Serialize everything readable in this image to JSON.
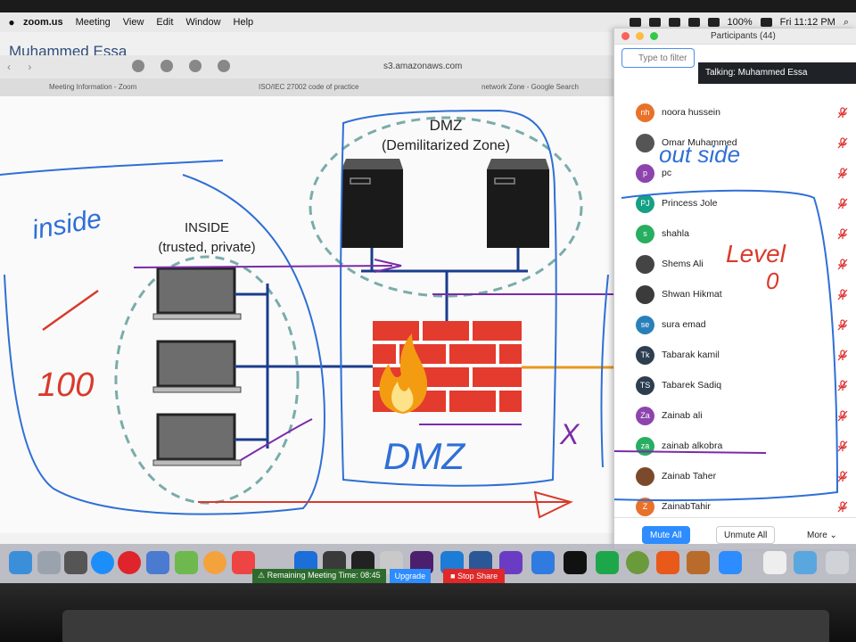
{
  "menubar": {
    "app": "zoom.us",
    "items": [
      "Meeting",
      "View",
      "Edit",
      "Window",
      "Help"
    ],
    "battery": "100%",
    "clock": "Fri 11:12 PM"
  },
  "window": {
    "meeting_name": "Muhammed Essa",
    "url": "s3.amazonaws.com",
    "tabs": [
      "Meeting Information - Zoom",
      "ISO/IEC 27002 code of practice",
      "network Zone - Google Search"
    ]
  },
  "diagram": {
    "dmz_title": "DMZ",
    "dmz_subtitle": "(Demilitarized Zone)",
    "inside_title": "INSIDE",
    "inside_subtitle": "(trusted, private)"
  },
  "annotations": {
    "inside": "inside",
    "check_mark": "✓",
    "score": "100",
    "dmz": "DMZ",
    "outside": "out side",
    "level": "Level",
    "level_num": "0",
    "x_mark": "X"
  },
  "panel": {
    "title": "Participants (44)",
    "search_placeholder": "Type to filter",
    "talking": "Talking: Muhammed Essa",
    "participants": [
      {
        "initials": "nh",
        "name": "noora hussein",
        "color": "#e8722a"
      },
      {
        "initials": "",
        "name": "Omar Muhammed",
        "color": "#555555"
      },
      {
        "initials": "p",
        "name": "pc",
        "color": "#8e44ad"
      },
      {
        "initials": "PJ",
        "name": "Princess Jole",
        "color": "#16a085"
      },
      {
        "initials": "s",
        "name": "shahla",
        "color": "#27ae60"
      },
      {
        "initials": "",
        "name": "Shems Ali",
        "color": "#444444"
      },
      {
        "initials": "",
        "name": "Shwan Hikmat",
        "color": "#3b3b3b"
      },
      {
        "initials": "se",
        "name": "sura emad",
        "color": "#2980b9"
      },
      {
        "initials": "Tk",
        "name": "Tabarak kamil",
        "color": "#2c3e50"
      },
      {
        "initials": "TS",
        "name": "Tabarek Sadiq",
        "color": "#2c3e50"
      },
      {
        "initials": "Za",
        "name": "Zainab ali",
        "color": "#8e44ad"
      },
      {
        "initials": "za",
        "name": "zainab alkobra",
        "color": "#27ae60"
      },
      {
        "initials": "",
        "name": "Zainab Taher",
        "color": "#7a4a2a"
      },
      {
        "initials": "Z",
        "name": "ZainabTahir",
        "color": "#e8722a"
      }
    ],
    "mute_all": "Mute All",
    "unmute_all": "Unmute All",
    "more": "More ⌄"
  },
  "zoom_toolbar": {
    "remaining": "⚠ Remaining Meeting Time: 08:45",
    "upgrade": "Upgrade",
    "stop_share": "■ Stop Share"
  }
}
